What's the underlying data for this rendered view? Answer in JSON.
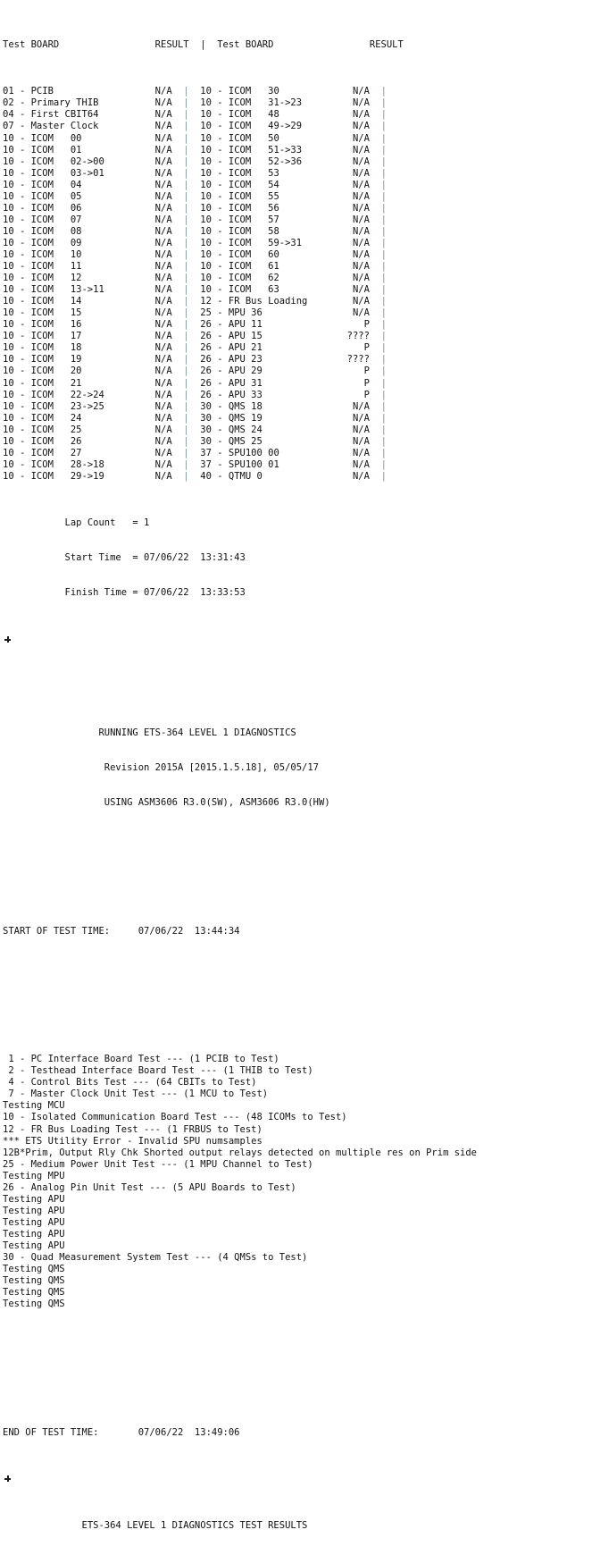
{
  "colors": {
    "background": "#ffffff",
    "text": "#111111",
    "separator": "#7e9494",
    "marker": "#1b1b1b"
  },
  "results_table": {
    "headers": {
      "left_test_board": "Test BOARD",
      "left_result": "RESULT",
      "separator": "|",
      "right_test_board": "Test BOARD",
      "right_result": "RESULT"
    },
    "header_line": "Test BOARD                 RESULT  |  Test BOARD                 RESULT",
    "rows": [
      {
        "left_board": "01 - PCIB",
        "left_result": "N/A",
        "right_board": "10 - ICOM   30",
        "right_result": "N/A",
        "right_tail": "|"
      },
      {
        "left_board": "02 - Primary THIB",
        "left_result": "N/A",
        "right_board": "10 - ICOM   31->23",
        "right_result": "N/A",
        "right_tail": "|"
      },
      {
        "left_board": "04 - First CBIT64",
        "left_result": "N/A",
        "right_board": "10 - ICOM   48",
        "right_result": "N/A",
        "right_tail": "|"
      },
      {
        "left_board": "07 - Master Clock",
        "left_result": "N/A",
        "right_board": "10 - ICOM   49->29",
        "right_result": "N/A",
        "right_tail": "|"
      },
      {
        "left_board": "10 - ICOM   00",
        "left_result": "N/A",
        "right_board": "10 - ICOM   50",
        "right_result": "N/A",
        "right_tail": "|"
      },
      {
        "left_board": "10 - ICOM   01",
        "left_result": "N/A",
        "right_board": "10 - ICOM   51->33",
        "right_result": "N/A",
        "right_tail": "|"
      },
      {
        "left_board": "10 - ICOM   02->00",
        "left_result": "N/A",
        "right_board": "10 - ICOM   52->36",
        "right_result": "N/A",
        "right_tail": "|"
      },
      {
        "left_board": "10 - ICOM   03->01",
        "left_result": "N/A",
        "right_board": "10 - ICOM   53",
        "right_result": "N/A",
        "right_tail": "|"
      },
      {
        "left_board": "10 - ICOM   04",
        "left_result": "N/A",
        "right_board": "10 - ICOM   54",
        "right_result": "N/A",
        "right_tail": "|"
      },
      {
        "left_board": "10 - ICOM   05",
        "left_result": "N/A",
        "right_board": "10 - ICOM   55",
        "right_result": "N/A",
        "right_tail": "|"
      },
      {
        "left_board": "10 - ICOM   06",
        "left_result": "N/A",
        "right_board": "10 - ICOM   56",
        "right_result": "N/A",
        "right_tail": "|"
      },
      {
        "left_board": "10 - ICOM   07",
        "left_result": "N/A",
        "right_board": "10 - ICOM   57",
        "right_result": "N/A",
        "right_tail": "|"
      },
      {
        "left_board": "10 - ICOM   08",
        "left_result": "N/A",
        "right_board": "10 - ICOM   58",
        "right_result": "N/A",
        "right_tail": "|"
      },
      {
        "left_board": "10 - ICOM   09",
        "left_result": "N/A",
        "right_board": "10 - ICOM   59->31",
        "right_result": "N/A",
        "right_tail": "|"
      },
      {
        "left_board": "10 - ICOM   10",
        "left_result": "N/A",
        "right_board": "10 - ICOM   60",
        "right_result": "N/A",
        "right_tail": "|"
      },
      {
        "left_board": "10 - ICOM   11",
        "left_result": "N/A",
        "right_board": "10 - ICOM   61",
        "right_result": "N/A",
        "right_tail": "|"
      },
      {
        "left_board": "10 - ICOM   12",
        "left_result": "N/A",
        "right_board": "10 - ICOM   62",
        "right_result": "N/A",
        "right_tail": "|"
      },
      {
        "left_board": "10 - ICOM   13->11",
        "left_result": "N/A",
        "right_board": "10 - ICOM   63",
        "right_result": "N/A",
        "right_tail": "|"
      },
      {
        "left_board": "10 - ICOM   14",
        "left_result": "N/A",
        "right_board": "12 - FR Bus Loading",
        "right_result": "N/A",
        "right_tail": "|"
      },
      {
        "left_board": "10 - ICOM   15",
        "left_result": "N/A",
        "right_board": "25 - MPU 36",
        "right_result": "N/A",
        "right_tail": "|"
      },
      {
        "left_board": "10 - ICOM   16",
        "left_result": "N/A",
        "right_board": "26 - APU 11",
        "right_result": "P",
        "right_tail": "|"
      },
      {
        "left_board": "10 - ICOM   17",
        "left_result": "N/A",
        "right_board": "26 - APU 15",
        "right_result": "????",
        "right_tail": "|"
      },
      {
        "left_board": "10 - ICOM   18",
        "left_result": "N/A",
        "right_board": "26 - APU 21",
        "right_result": "P",
        "right_tail": "|"
      },
      {
        "left_board": "10 - ICOM   19",
        "left_result": "N/A",
        "right_board": "26 - APU 23",
        "right_result": "????",
        "right_tail": "|"
      },
      {
        "left_board": "10 - ICOM   20",
        "left_result": "N/A",
        "right_board": "26 - APU 29",
        "right_result": "P",
        "right_tail": "|"
      },
      {
        "left_board": "10 - ICOM   21",
        "left_result": "N/A",
        "right_board": "26 - APU 31",
        "right_result": "P",
        "right_tail": "|"
      },
      {
        "left_board": "10 - ICOM   22->24",
        "left_result": "N/A",
        "right_board": "26 - APU 33",
        "right_result": "P",
        "right_tail": "|"
      },
      {
        "left_board": "10 - ICOM   23->25",
        "left_result": "N/A",
        "right_board": "30 - QMS 18",
        "right_result": "N/A",
        "right_tail": "|"
      },
      {
        "left_board": "10 - ICOM   24",
        "left_result": "N/A",
        "right_board": "30 - QMS 19",
        "right_result": "N/A",
        "right_tail": "|"
      },
      {
        "left_board": "10 - ICOM   25",
        "left_result": "N/A",
        "right_board": "30 - QMS 24",
        "right_result": "N/A",
        "right_tail": "|"
      },
      {
        "left_board": "10 - ICOM   26",
        "left_result": "N/A",
        "right_board": "30 - QMS 25",
        "right_result": "N/A",
        "right_tail": "|"
      },
      {
        "left_board": "10 - ICOM   27",
        "left_result": "N/A",
        "right_board": "37 - SPU100 00",
        "right_result": "N/A",
        "right_tail": "|"
      },
      {
        "left_board": "10 - ICOM   28->18",
        "left_result": "N/A",
        "right_board": "37 - SPU100 01",
        "right_result": "N/A",
        "right_tail": "|"
      },
      {
        "left_board": "10 - ICOM   29->19",
        "left_result": "N/A",
        "right_board": "40 - QTMU 0",
        "right_result": "N/A",
        "right_tail": "|"
      }
    ]
  },
  "summary": {
    "lap_count_label": "Lap Count",
    "lap_count_value": "= 1",
    "start_time_label": "Start Time",
    "start_time_value": "= 07/06/22  13:31:43",
    "finish_time_label": "Finish Time",
    "finish_time_value": "= 07/06/22  13:33:53",
    "lap_count_line": "           Lap Count   = 1",
    "start_time_line": "           Start Time  = 07/06/22  13:31:43",
    "finish_time_line": "           Finish Time = 07/06/22  13:33:53"
  },
  "banner": {
    "title": "RUNNING ETS-364 LEVEL 1 DIAGNOSTICS",
    "revision": "Revision 2015A [2015.1.5.18], 05/05/17",
    "using": "USING ASM3606 R3.0(SW), ASM3606 R3.0(HW)",
    "title_line": "                 RUNNING ETS-364 LEVEL 1 DIAGNOSTICS",
    "revision_line": "                  Revision 2015A [2015.1.5.18], 05/05/17",
    "using_line": "                  USING ASM3606 R3.0(SW), ASM3606 R3.0(HW)"
  },
  "start_of_test": {
    "label": "START OF TEST TIME:",
    "value": "07/06/22  13:44:34",
    "line": "START OF TEST TIME:     07/06/22  13:44:34"
  },
  "end_of_test": {
    "label": "END OF TEST TIME:",
    "value": "07/06/22  13:49:06",
    "line": "END OF TEST TIME:       07/06/22  13:49:06"
  },
  "test_log": {
    "lines": [
      " 1 - PC Interface Board Test --- (1 PCIB to Test)",
      " 2 - Testhead Interface Board Test --- (1 THIB to Test)",
      " 4 - Control Bits Test --- (64 CBITs to Test)",
      " 7 - Master Clock Unit Test --- (1 MCU to Test)",
      "Testing MCU",
      "10 - Isolated Communication Board Test --- (48 ICOMs to Test)",
      "12 - FR Bus Loading Test --- (1 FRBUS to Test)",
      "*** ETS Utility Error - Invalid SPU numsamples",
      "12B*Prim, Output Rly Chk Shorted output relays detected on multiple res on Prim side",
      "25 - Medium Power Unit Test --- (1 MPU Channel to Test)",
      "Testing MPU",
      "26 - Analog Pin Unit Test --- (5 APU Boards to Test)",
      "Testing APU",
      "Testing APU",
      "Testing APU",
      "Testing APU",
      "Testing APU",
      "30 - Quad Measurement System Test --- (4 QMSs to Test)",
      "Testing QMS",
      "Testing QMS",
      "Testing QMS",
      "Testing QMS"
    ]
  },
  "footer": {
    "results_title": "ETS-364 LEVEL 1 DIAGNOSTICS TEST RESULTS",
    "results_title_line": "              ETS-364 LEVEL 1 DIAGNOSTICS TEST RESULTS"
  }
}
